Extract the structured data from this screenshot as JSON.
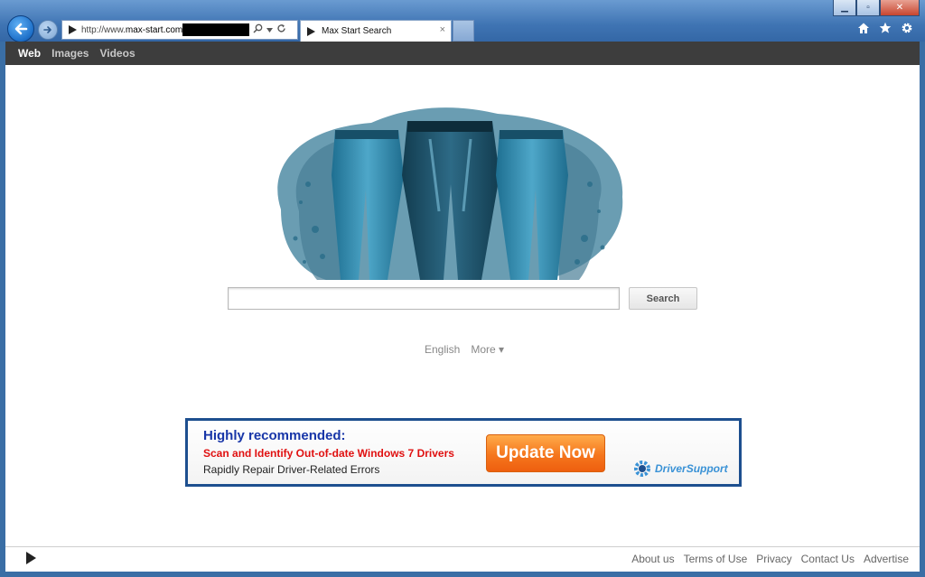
{
  "browser": {
    "address": {
      "prefix": "http://www.",
      "domain": "max-start.com"
    },
    "tab": {
      "title": "Max Start Search",
      "close_glyph": "×"
    },
    "window_controls": {
      "minimize": "▁",
      "maximize": "▫",
      "close": "✕"
    },
    "icons": [
      "home-icon",
      "star-icon",
      "gear-icon"
    ]
  },
  "navbar": {
    "items": [
      {
        "label": "Web",
        "active": true
      },
      {
        "label": "Images",
        "active": false
      },
      {
        "label": "Videos",
        "active": false
      }
    ]
  },
  "search": {
    "button_label": "Search",
    "value": ""
  },
  "language": {
    "current": "English",
    "more": "More ▾"
  },
  "ad": {
    "title": "Highly recommended:",
    "line1": "Scan and Identify Out-of-date Windows 7 Drivers",
    "line2": "Rapidly Repair Driver-Related Errors",
    "cta": "Update Now",
    "brand_a": "Driver",
    "brand_b": "Support"
  },
  "footer": {
    "links": [
      "About us",
      "Terms of Use",
      "Privacy",
      "Contact Us",
      "Advertise"
    ]
  },
  "colors": {
    "navbar_bg": "#3d3d3d",
    "ad_border": "#1d4f8f",
    "ad_title": "#1836a8",
    "ad_alert": "#e01010",
    "cta_orange": "#f5761d"
  }
}
